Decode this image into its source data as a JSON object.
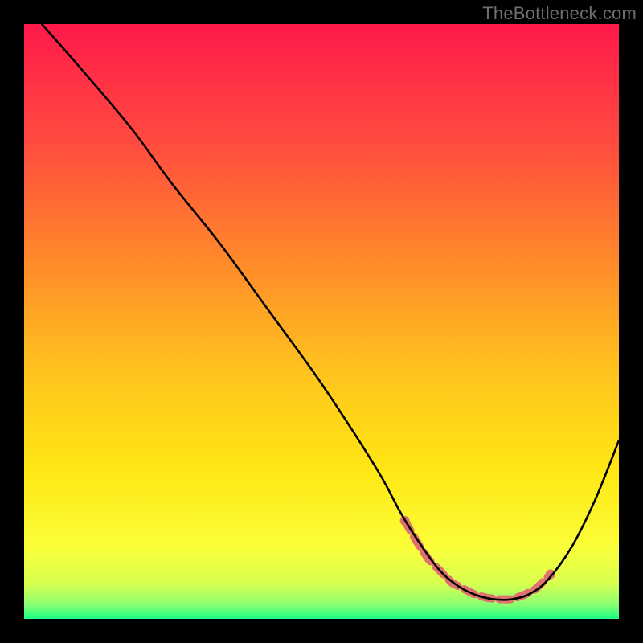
{
  "watermark": "TheBottleneck.com",
  "chart_data": {
    "type": "line",
    "title": "",
    "xlabel": "",
    "ylabel": "",
    "xlim": [
      0,
      100
    ],
    "ylim": [
      0,
      100
    ],
    "grid": false,
    "legend": false,
    "background_gradient": {
      "stops": [
        {
          "offset": 0.0,
          "color": "#ff1a4b"
        },
        {
          "offset": 0.2,
          "color": "#ff4b3f"
        },
        {
          "offset": 0.4,
          "color": "#ff8a2a"
        },
        {
          "offset": 0.58,
          "color": "#ffc21e"
        },
        {
          "offset": 0.75,
          "color": "#ffe714"
        },
        {
          "offset": 0.88,
          "color": "#fbff3a"
        },
        {
          "offset": 0.94,
          "color": "#d8ff4e"
        },
        {
          "offset": 0.975,
          "color": "#8dff71"
        },
        {
          "offset": 1.0,
          "color": "#1aff84"
        }
      ]
    },
    "series": [
      {
        "name": "bottleneck-curve",
        "color": "#000000",
        "x": [
          3,
          10,
          18,
          25,
          33,
          41,
          49,
          55,
          60,
          63.5,
          67,
          70,
          73,
          76,
          79,
          82,
          85,
          88,
          92,
          96,
          100
        ],
        "y": [
          100,
          92,
          82.5,
          73,
          63,
          52,
          41,
          32,
          24,
          17.5,
          12,
          8,
          5.5,
          4,
          3.3,
          3.3,
          4.2,
          6.5,
          12,
          20,
          30
        ]
      }
    ],
    "markers": {
      "name": "highlight-region",
      "color": "#e0716e",
      "points": [
        {
          "x": 64,
          "y": 16.5
        },
        {
          "x": 66,
          "y": 13
        },
        {
          "x": 68,
          "y": 10
        },
        {
          "x": 70,
          "y": 8
        },
        {
          "x": 72,
          "y": 6
        },
        {
          "x": 74,
          "y": 5
        },
        {
          "x": 76,
          "y": 4
        },
        {
          "x": 78,
          "y": 3.5
        },
        {
          "x": 80,
          "y": 3.3
        },
        {
          "x": 82,
          "y": 3.3
        },
        {
          "x": 84,
          "y": 4
        },
        {
          "x": 86,
          "y": 5
        },
        {
          "x": 88.5,
          "y": 7.5
        }
      ]
    }
  }
}
